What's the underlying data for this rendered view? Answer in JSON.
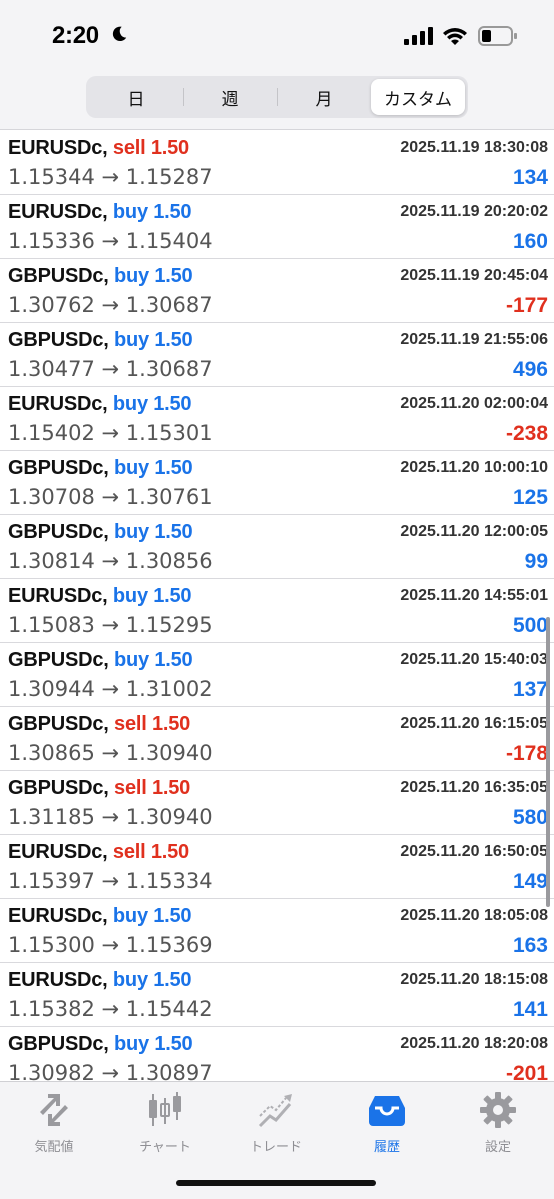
{
  "status_bar": {
    "time": "2:20"
  },
  "periods": [
    {
      "label": "日",
      "active": false
    },
    {
      "label": "週",
      "active": false
    },
    {
      "label": "月",
      "active": false
    },
    {
      "label": "カスタム",
      "active": true
    }
  ],
  "trades": [
    {
      "symbol": "EURUSDc,",
      "side": "sell",
      "volume": "1.50",
      "datetime": "2025.11.19 18:30:08",
      "prices": "1.15344 → 1.15287",
      "profit": "134"
    },
    {
      "symbol": "EURUSDc,",
      "side": "buy",
      "volume": "1.50",
      "datetime": "2025.11.19 20:20:02",
      "prices": "1.15336 → 1.15404",
      "profit": "160"
    },
    {
      "symbol": "GBPUSDc,",
      "side": "buy",
      "volume": "1.50",
      "datetime": "2025.11.19 20:45:04",
      "prices": "1.30762 → 1.30687",
      "profit": "-177"
    },
    {
      "symbol": "GBPUSDc,",
      "side": "buy",
      "volume": "1.50",
      "datetime": "2025.11.19 21:55:06",
      "prices": "1.30477 → 1.30687",
      "profit": "496"
    },
    {
      "symbol": "EURUSDc,",
      "side": "buy",
      "volume": "1.50",
      "datetime": "2025.11.20 02:00:04",
      "prices": "1.15402 → 1.15301",
      "profit": "-238"
    },
    {
      "symbol": "GBPUSDc,",
      "side": "buy",
      "volume": "1.50",
      "datetime": "2025.11.20 10:00:10",
      "prices": "1.30708 → 1.30761",
      "profit": "125"
    },
    {
      "symbol": "GBPUSDc,",
      "side": "buy",
      "volume": "1.50",
      "datetime": "2025.11.20 12:00:05",
      "prices": "1.30814 → 1.30856",
      "profit": "99"
    },
    {
      "symbol": "EURUSDc,",
      "side": "buy",
      "volume": "1.50",
      "datetime": "2025.11.20 14:55:01",
      "prices": "1.15083 → 1.15295",
      "profit": "500"
    },
    {
      "symbol": "GBPUSDc,",
      "side": "buy",
      "volume": "1.50",
      "datetime": "2025.11.20 15:40:03",
      "prices": "1.30944 → 1.31002",
      "profit": "137"
    },
    {
      "symbol": "GBPUSDc,",
      "side": "sell",
      "volume": "1.50",
      "datetime": "2025.11.20 16:15:05",
      "prices": "1.30865 → 1.30940",
      "profit": "-178"
    },
    {
      "symbol": "GBPUSDc,",
      "side": "sell",
      "volume": "1.50",
      "datetime": "2025.11.20 16:35:05",
      "prices": "1.31185 → 1.30940",
      "profit": "580"
    },
    {
      "symbol": "EURUSDc,",
      "side": "sell",
      "volume": "1.50",
      "datetime": "2025.11.20 16:50:05",
      "prices": "1.15397 → 1.15334",
      "profit": "149"
    },
    {
      "symbol": "EURUSDc,",
      "side": "buy",
      "volume": "1.50",
      "datetime": "2025.11.20 18:05:08",
      "prices": "1.15300 → 1.15369",
      "profit": "163"
    },
    {
      "symbol": "EURUSDc,",
      "side": "buy",
      "volume": "1.50",
      "datetime": "2025.11.20 18:15:08",
      "prices": "1.15382 → 1.15442",
      "profit": "141"
    },
    {
      "symbol": "GBPUSDc,",
      "side": "buy",
      "volume": "1.50",
      "datetime": "2025.11.20 18:20:08",
      "prices": "1.30982 → 1.30897",
      "profit": "-201"
    }
  ],
  "tabs": [
    {
      "label": "気配値",
      "icon": "quotes-icon",
      "active": false
    },
    {
      "label": "チャート",
      "icon": "chart-icon",
      "active": false
    },
    {
      "label": "トレード",
      "icon": "trade-icon",
      "active": false
    },
    {
      "label": "履歴",
      "icon": "history-icon",
      "active": true
    },
    {
      "label": "設定",
      "icon": "settings-icon",
      "active": false
    }
  ],
  "colors": {
    "buy": "#1a73e8",
    "sell": "#e0301e",
    "profit_positive": "#1a73e8",
    "profit_negative": "#e0301e",
    "tab_active": "#1a73e8",
    "tab_inactive": "#8e8e93"
  }
}
